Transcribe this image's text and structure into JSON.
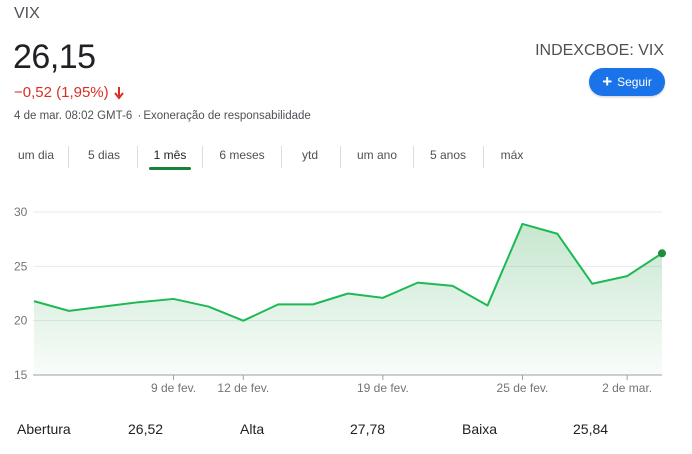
{
  "header": {
    "symbol": "VIX",
    "price": "26,15",
    "exchange": "INDEXCBOE: VIX",
    "change": "−0,52 (1,95%)",
    "timestamp": "4 de mar. 08:02 GMT-6",
    "disclaimer": "Exoneração de responsabilidade",
    "follow_label": "Seguir",
    "colors": {
      "negative": "#d93025",
      "accent": "#1a73e8",
      "line": "#1db954"
    }
  },
  "range_tabs": [
    {
      "label": "um dia"
    },
    {
      "label": "5 dias"
    },
    {
      "label": "1 mês",
      "active": true
    },
    {
      "label": "6 meses"
    },
    {
      "label": "ytd"
    },
    {
      "label": "um ano"
    },
    {
      "label": "5 anos"
    },
    {
      "label": "máx"
    }
  ],
  "stats": {
    "open_label": "Abertura",
    "open_value": "26,52",
    "high_label": "Alta",
    "high_value": "27,78",
    "low_label": "Baixa",
    "low_value": "25,84"
  },
  "chart_data": {
    "type": "area",
    "ylim": [
      15,
      30
    ],
    "yticks": [
      "30",
      "25",
      "20",
      "15"
    ],
    "ytick_values": [
      30,
      25,
      20,
      15
    ],
    "xtick_labels": [
      "9 de fev.",
      "12 de fev.",
      "19 de fev.",
      "25 de fev.",
      "2 de mar."
    ],
    "xtick_index": [
      4,
      6,
      10,
      14,
      17
    ],
    "series": [
      {
        "values": [
          21.8,
          20.9,
          21.3,
          21.7,
          22.0,
          21.3,
          20.0,
          21.5,
          21.5,
          22.5,
          22.1,
          23.5,
          23.2,
          21.4,
          28.9,
          28.0,
          23.4,
          24.1,
          26.2
        ]
      }
    ],
    "grid": true,
    "last_point_marker": true
  }
}
